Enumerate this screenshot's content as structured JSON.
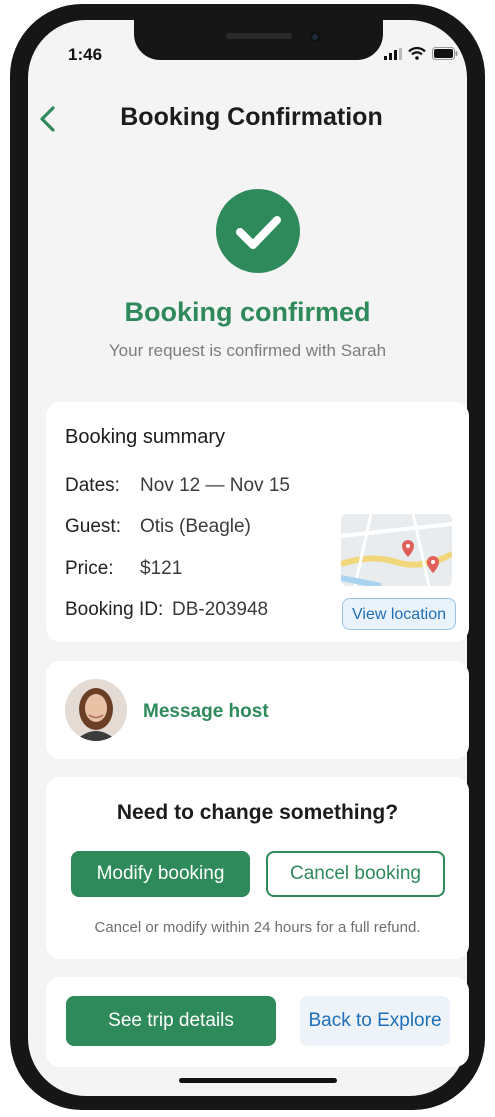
{
  "status_bar": {
    "time": "1:46",
    "icons": [
      "signal-icon",
      "wifi-icon",
      "battery-icon"
    ]
  },
  "nav": {
    "title": "Booking Confirmation",
    "back_icon": "chevron-left-icon"
  },
  "confirmation": {
    "icon": "checkmark-icon",
    "title": "Booking confirmed",
    "subtitle": "Your request is confirmed with Sarah"
  },
  "summary": {
    "title": "Booking summary",
    "rows": [
      {
        "label": "Dates:",
        "value": "Nov 12 — Nov 15"
      },
      {
        "label": "Guest:",
        "value": "Otis (Beagle)"
      },
      {
        "label": "Price:",
        "value": "$121"
      },
      {
        "label": "Booking ID:",
        "value": "DB-203948"
      }
    ],
    "map_icon": "map-thumbnail",
    "view_location_label": "View location"
  },
  "host": {
    "avatar": "host-avatar",
    "message_label": "Message host"
  },
  "change": {
    "title": "Need to change something?",
    "modify_label": "Modify booking",
    "cancel_label": "Cancel booking",
    "note": "Cancel or modify within 24 hours for a full refund."
  },
  "actions": {
    "trip_details_label": "See trip details",
    "explore_label": "Back to Explore"
  },
  "colors": {
    "accent_green": "#2e8a5a",
    "link_blue": "#1f6fb8",
    "background": "#f3f4f3"
  }
}
